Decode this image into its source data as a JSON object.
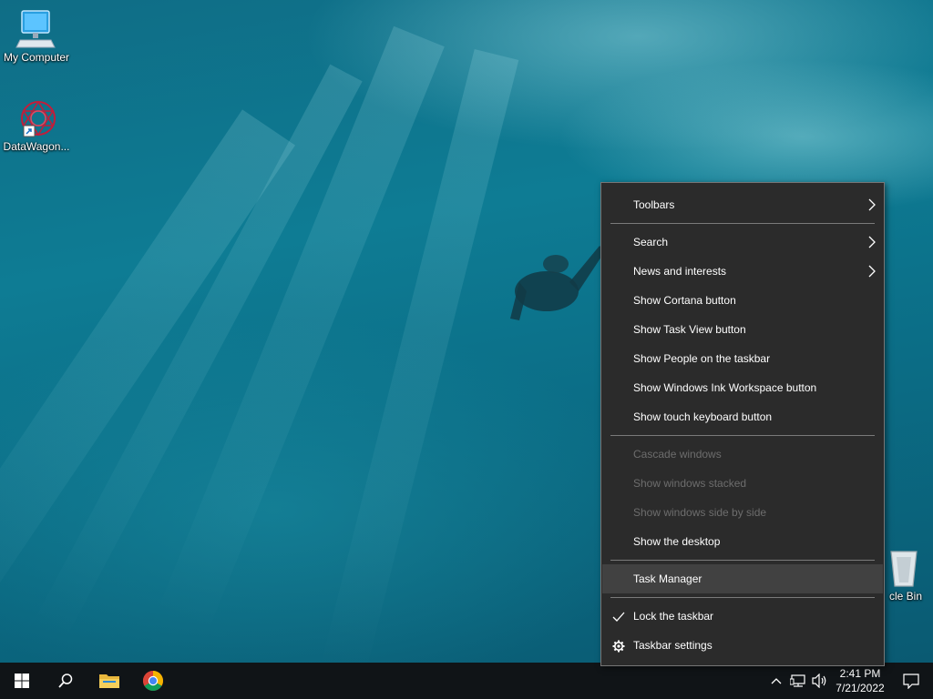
{
  "desktop": {
    "icons": [
      {
        "label": "My Computer",
        "icon": "computer-icon"
      },
      {
        "label": "DataWagon...",
        "icon": "datawagon-icon"
      },
      {
        "label": "cle Bin",
        "icon": "recycle-bin-icon"
      }
    ]
  },
  "context_menu": {
    "items": [
      {
        "label": "Toolbars",
        "submenu": true
      },
      {
        "label": "Search",
        "submenu": true
      },
      {
        "label": "News and interests",
        "submenu": true
      },
      {
        "label": "Show Cortana button"
      },
      {
        "label": "Show Task View button"
      },
      {
        "label": "Show People on the taskbar"
      },
      {
        "label": "Show Windows Ink Workspace button"
      },
      {
        "label": "Show touch keyboard button"
      },
      {
        "label": "Cascade windows",
        "disabled": true
      },
      {
        "label": "Show windows stacked",
        "disabled": true
      },
      {
        "label": "Show windows side by side",
        "disabled": true
      },
      {
        "label": "Show the desktop"
      },
      {
        "label": "Task Manager",
        "highlighted": true
      },
      {
        "label": "Lock the taskbar",
        "checked": true
      },
      {
        "label": "Taskbar settings",
        "icon": "gear-icon"
      }
    ]
  },
  "taskbar": {
    "buttons": [
      {
        "name": "start-button",
        "icon": "windows-logo-icon"
      },
      {
        "name": "search-button",
        "icon": "search-icon"
      },
      {
        "name": "file-explorer-button",
        "icon": "folder-icon"
      },
      {
        "name": "chrome-button",
        "icon": "chrome-icon"
      }
    ],
    "tray": {
      "time": "2:41 PM",
      "date": "7/21/2022"
    }
  },
  "colors": {
    "menu_bg": "#2b2b2b",
    "menu_hover": "#414141",
    "taskbar_bg": "#101417"
  }
}
